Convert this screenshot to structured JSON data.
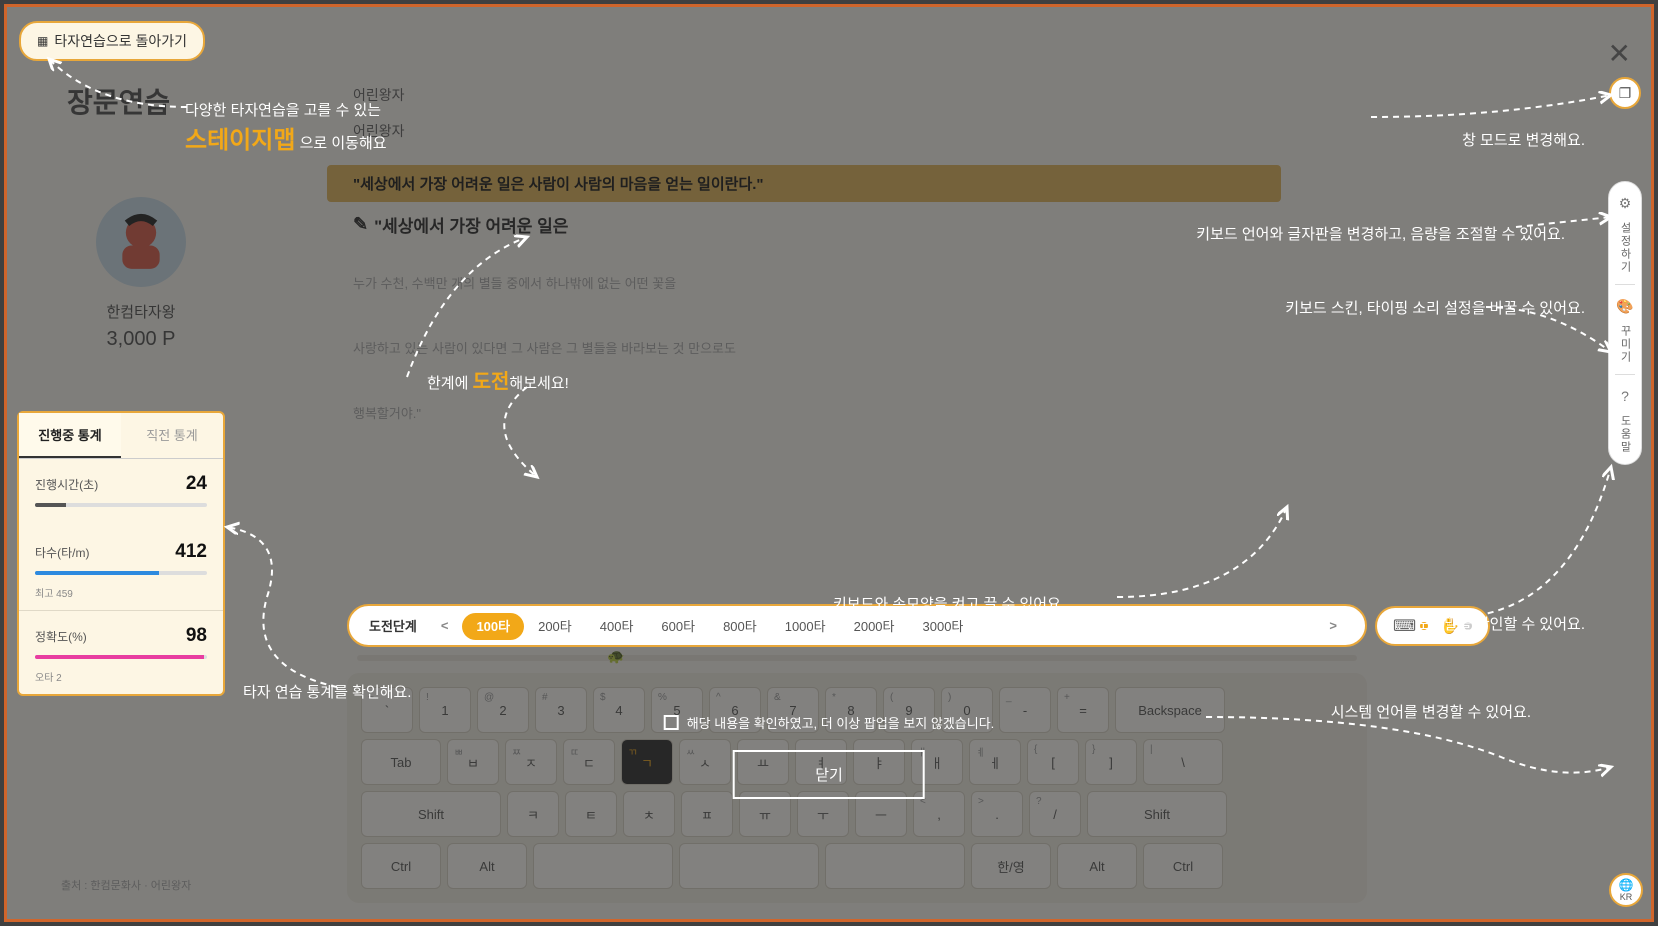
{
  "back_button": "타자연습으로 돌아가기",
  "page_title": "장문연습",
  "user": {
    "name": "한컴타자왕",
    "points": "3,000 P"
  },
  "stats": {
    "tab_active": "진행중 통계",
    "tab_other": "직전 통계",
    "time_label": "진행시간(초)",
    "time_value": "24",
    "speed_label": "타수(타/m)",
    "speed_value": "412",
    "speed_sub": "최고 459",
    "acc_label": "정확도(%)",
    "acc_value": "98",
    "acc_sub": "오타 2"
  },
  "content": {
    "line1": "어린왕자",
    "line2": "어린왕자",
    "highlight": "\"세상에서 가장 어려운 일은 사람이 사람의 마음을 얻는 일이란다.\"",
    "input": "\"세상에서 가장 어려운 일은",
    "next1": "누가 수천, 수백만 개의 별들 중에서 하나밖에 없는 어떤 꽃을",
    "next2": "사랑하고 있는 사람이 있다면 그 사람은 그 별들을 바라보는 것 만으로도",
    "next3": "행복할거야.\""
  },
  "levels": {
    "label": "도전단계",
    "items": [
      "100타",
      "200타",
      "400타",
      "600타",
      "800타",
      "1000타",
      "2000타",
      "3000타"
    ],
    "active_index": 0
  },
  "right_menu": {
    "settings": "설정하기",
    "decorate": "꾸미기",
    "help": "도움말",
    "lang": "KR"
  },
  "popup": {
    "checkbox_label": "해당 내용을 확인하였고, 더 이상 팝업을 보지 않겠습니다.",
    "close": "닫기"
  },
  "annotations": {
    "a1_pre": "다양한 타자연습을 고를 수 있는",
    "a1_em": "스테이지맵",
    "a1_post": "으로 이동해요",
    "a2_pre": "한계에 ",
    "a2_em": "도전",
    "a2_post": "해보세요!",
    "a3": "타자 연습 통계를 확인해요.",
    "a4": "창 모드로 변경해요.",
    "a5": "키보드 언어와 글자판을 변경하고, 음량을 조절할 수 있어요.",
    "a6": "키보드 스킨, 타이핑 소리 설정을 바꿀 수 있어요.",
    "a7": "도움말을 확인할 수 있어요.",
    "a8": "키보드와 손모양을 켜고 끌 수 있어요.",
    "a9": "시스템 언어를 변경할 수 있어요."
  },
  "source": "출처 : 한컴문화사 · 어린왕자",
  "keyboard": {
    "row1": [
      {
        "u": "~",
        "m": "`"
      },
      {
        "u": "!",
        "m": "1"
      },
      {
        "u": "@",
        "m": "2"
      },
      {
        "u": "#",
        "m": "3"
      },
      {
        "u": "$",
        "m": "4"
      },
      {
        "u": "%",
        "m": "5"
      },
      {
        "u": "^",
        "m": "6"
      },
      {
        "u": "&",
        "m": "7"
      },
      {
        "u": "*",
        "m": "8"
      },
      {
        "u": "(",
        "m": "9"
      },
      {
        "u": ")",
        "m": "0"
      },
      {
        "u": "_",
        "m": "-"
      },
      {
        "u": "+",
        "m": "="
      },
      {
        "m": "Backspace",
        "w": "wider"
      }
    ],
    "row2": [
      {
        "m": "Tab",
        "w": "wide"
      },
      {
        "u": "ㅃ",
        "m": "ㅂ"
      },
      {
        "u": "ㅉ",
        "m": "ㅈ"
      },
      {
        "u": "ㄸ",
        "m": "ㄷ"
      },
      {
        "u": "ㄲ",
        "m": "ㄱ",
        "active": true
      },
      {
        "u": "ㅆ",
        "m": "ㅅ"
      },
      {
        "m": "ㅛ"
      },
      {
        "m": "ㅕ"
      },
      {
        "m": "ㅑ"
      },
      {
        "u": "ㅒ",
        "m": "ㅐ"
      },
      {
        "u": "ㅖ",
        "m": "ㅔ"
      },
      {
        "u": "{",
        "m": "["
      },
      {
        "u": "}",
        "m": "]"
      },
      {
        "u": "|",
        "m": "\\",
        "w": "wide"
      }
    ],
    "row4": [
      {
        "m": "Shift",
        "w": "widest"
      },
      {
        "m": "ㅋ"
      },
      {
        "m": "ㅌ"
      },
      {
        "m": "ㅊ"
      },
      {
        "m": "ㅍ"
      },
      {
        "m": "ㅠ"
      },
      {
        "m": "ㅜ"
      },
      {
        "m": "ㅡ"
      },
      {
        "u": "<",
        "m": ","
      },
      {
        "u": ">",
        "m": "."
      },
      {
        "u": "?",
        "m": "/"
      },
      {
        "m": "Shift",
        "w": "widest"
      }
    ],
    "row5": [
      {
        "m": "Ctrl",
        "w": "wide"
      },
      {
        "m": "Alt",
        "w": "wide"
      },
      {
        "m": "",
        "w": "widest"
      },
      {
        "m": "",
        "w": "widest"
      },
      {
        "m": "",
        "w": "widest"
      },
      {
        "m": "한/영",
        "w": "wide"
      },
      {
        "m": "Alt",
        "w": "wide"
      },
      {
        "m": "Ctrl",
        "w": "wide"
      }
    ]
  }
}
